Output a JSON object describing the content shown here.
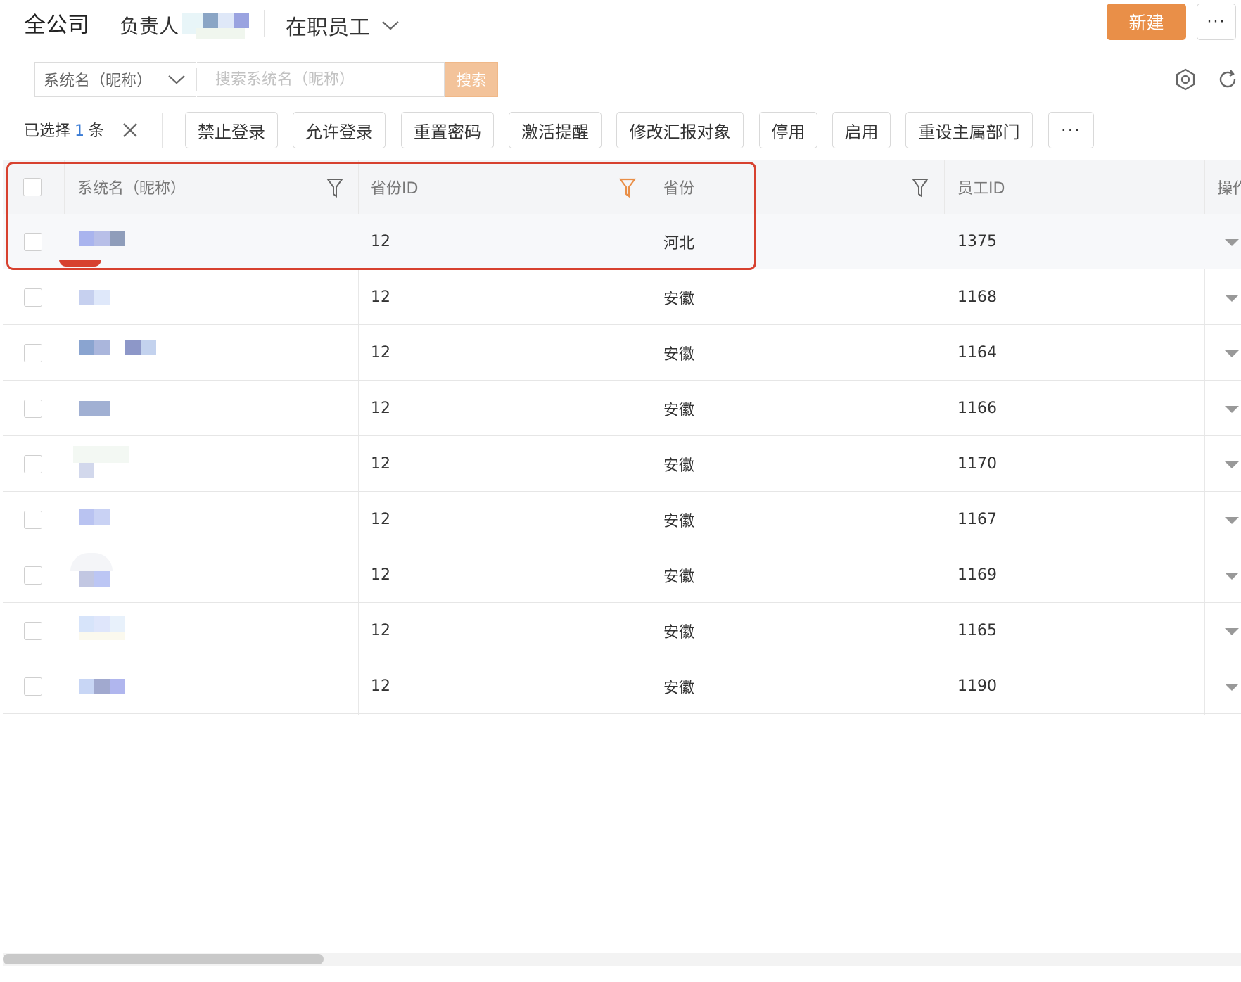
{
  "header": {
    "company": "全公司",
    "owner_label": "负责人",
    "status_filter": "在职员工",
    "new_button": "新建",
    "more_button": "···"
  },
  "search": {
    "field_select": "系统名（昵称）",
    "placeholder": "搜索系统名（昵称）",
    "button": "搜索"
  },
  "selection": {
    "prefix": "已选择",
    "count": "1",
    "suffix": "条"
  },
  "toolbar": {
    "buttons": [
      "禁止登录",
      "允许登录",
      "重置密码",
      "激活提醒",
      "修改汇报对象",
      "停用",
      "启用",
      "重设主属部门"
    ],
    "more": "···"
  },
  "table": {
    "columns": [
      "系统名（昵称）",
      "省份ID",
      "省份",
      "员工ID",
      "操作"
    ],
    "rows": [
      {
        "province_id": "12",
        "province": "河北",
        "employee_id": "1375"
      },
      {
        "province_id": "12",
        "province": "安徽",
        "employee_id": "1168"
      },
      {
        "province_id": "12",
        "province": "安徽",
        "employee_id": "1164"
      },
      {
        "province_id": "12",
        "province": "安徽",
        "employee_id": "1166"
      },
      {
        "province_id": "12",
        "province": "安徽",
        "employee_id": "1170"
      },
      {
        "province_id": "12",
        "province": "安徽",
        "employee_id": "1167"
      },
      {
        "province_id": "12",
        "province": "安徽",
        "employee_id": "1169"
      },
      {
        "province_id": "12",
        "province": "安徽",
        "employee_id": "1165"
      },
      {
        "province_id": "12",
        "province": "安徽",
        "employee_id": "1190"
      }
    ]
  },
  "colors": {
    "accent": "#e98f48",
    "search_button": "#f3c39a",
    "highlight_box": "#d7412f",
    "active_filter": "#e98f48"
  }
}
